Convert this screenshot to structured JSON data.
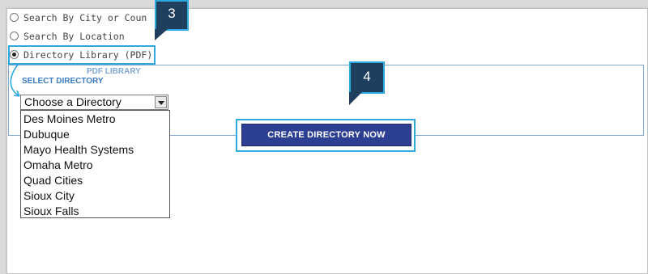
{
  "search_options": [
    {
      "label": "Search By City or Coun",
      "checked": false
    },
    {
      "label": "Search By Location",
      "checked": false
    },
    {
      "label": "Directory Library (PDF)",
      "checked": true
    }
  ],
  "callouts": {
    "step3": "3",
    "step4": "4"
  },
  "panel": {
    "title": "PDF LIBRARY",
    "select_label": "SELECT DIRECTORY",
    "select_value": "Choose a Directory",
    "options": [
      "Des Moines Metro",
      "Dubuque",
      "Mayo Health Systems",
      "Omaha Metro",
      "Quad Cities",
      "Sioux City",
      "Sioux Falls"
    ],
    "button_label": "CREATE DIRECTORY NOW"
  },
  "colors": {
    "accent": "#2fa8e0",
    "button": "#2c3f92",
    "callout": "#1f3f5e",
    "label": "#3d7cc4"
  }
}
